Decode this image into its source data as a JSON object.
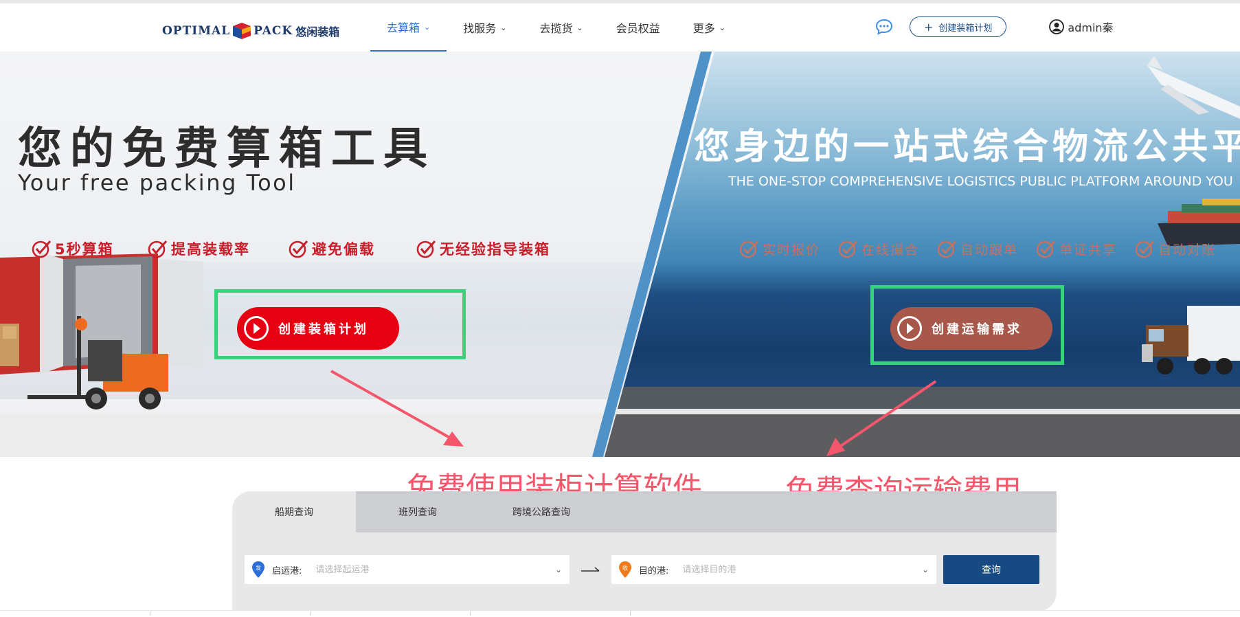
{
  "brand": {
    "logo_latin_1": "OPTIMAL",
    "logo_latin_2": "PACK",
    "logo_cn": "悠闲装箱"
  },
  "nav": {
    "items": [
      {
        "label": "去算箱",
        "dropdown": true,
        "active": true
      },
      {
        "label": "找服务",
        "dropdown": true
      },
      {
        "label": "去揽货",
        "dropdown": true
      },
      {
        "label": "会员权益",
        "dropdown": false
      },
      {
        "label": "更多",
        "dropdown": true
      }
    ],
    "chevron": "⌄",
    "create_plan": "创建装箱计划",
    "create_plus": "+",
    "user": "admin秦"
  },
  "hero": {
    "left": {
      "title": "您的免费算箱工具",
      "subtitle": "Your free packing Tool",
      "features": [
        "5秒算箱",
        "提高装载率",
        "避免偏载",
        "无经验指导装箱"
      ],
      "cta": "创建装箱计划"
    },
    "right": {
      "title": "您身边的一站式综合物流公共平台",
      "subtitle": "THE ONE-STOP COMPREHENSIVE LOGISTICS PUBLIC PLATFORM AROUND YOU",
      "features": [
        "实时报价",
        "在线撮合",
        "自动跟单",
        "单证共享",
        "自动对账"
      ],
      "cta": "创建运输需求"
    }
  },
  "annotations": {
    "left": "免费使用装柜计算软件",
    "right": "免费查询运输费用",
    "color": "#f4566c",
    "highlight_color": "#36d37a"
  },
  "search": {
    "tabs": [
      "船期查询",
      "班列查询",
      "跨境公路查询"
    ],
    "from": {
      "badge": "发",
      "label": "启运港:",
      "placeholder": "请选择起运港"
    },
    "to": {
      "badge": "收",
      "label": "目的港:",
      "placeholder": "请选择目的港"
    },
    "query_button": "查询"
  },
  "colors": {
    "primary_blue": "#2f6fd7",
    "navy": "#174a82",
    "cta_red": "#e60012",
    "cta_brown": "#a8584a",
    "feature_red": "#c81f2b"
  }
}
